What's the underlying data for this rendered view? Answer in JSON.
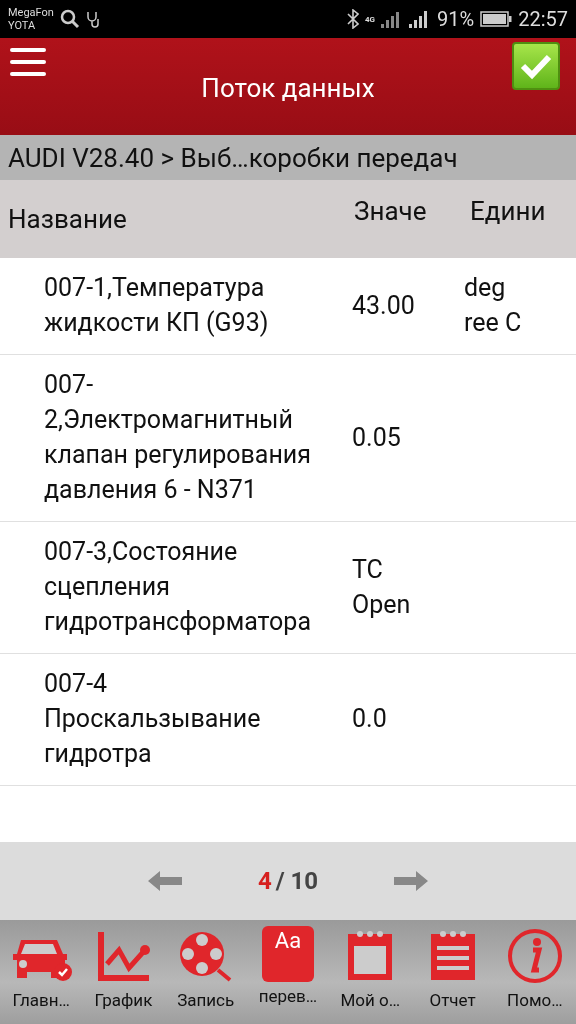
{
  "status_bar": {
    "carrier_1": "MegaFon",
    "carrier_2": "YOTA",
    "network": "4G",
    "battery": "91%",
    "time": "22:57"
  },
  "header": {
    "title": "Поток данных",
    "confirmed": true
  },
  "breadcrumb": "AUDI V28.40 > Выб…коробки передач",
  "table": {
    "columns": [
      "Название",
      "Значе",
      "Едини"
    ],
    "rows": [
      {
        "name": "007-1,Температура жидкости КП (G93)",
        "value": "43.00",
        "unit": "deg ree C"
      },
      {
        "name": "007-2,Электромагнитный клапан регулирования давления 6 - N371",
        "value": "0.05",
        "unit": ""
      },
      {
        "name": "007-3,Состояние сцепления гидротрансформатора",
        "value": "TC Open",
        "unit": ""
      },
      {
        "name": "007-4 Проскальзывание гидротра",
        "value": "0.0",
        "unit": ""
      }
    ]
  },
  "pager": {
    "current": "4",
    "total": "/ 10"
  },
  "toolbar": [
    {
      "kind": "car",
      "label": "Главн…"
    },
    {
      "kind": "graph",
      "label": "График"
    },
    {
      "kind": "record",
      "label": "Запись"
    },
    {
      "kind": "translate",
      "label": "перев…",
      "icon_text": "Aa"
    },
    {
      "kind": "calendar",
      "label": "Мой о…"
    },
    {
      "kind": "report",
      "label": "Отчет"
    },
    {
      "kind": "info",
      "label": "Помо…"
    }
  ]
}
